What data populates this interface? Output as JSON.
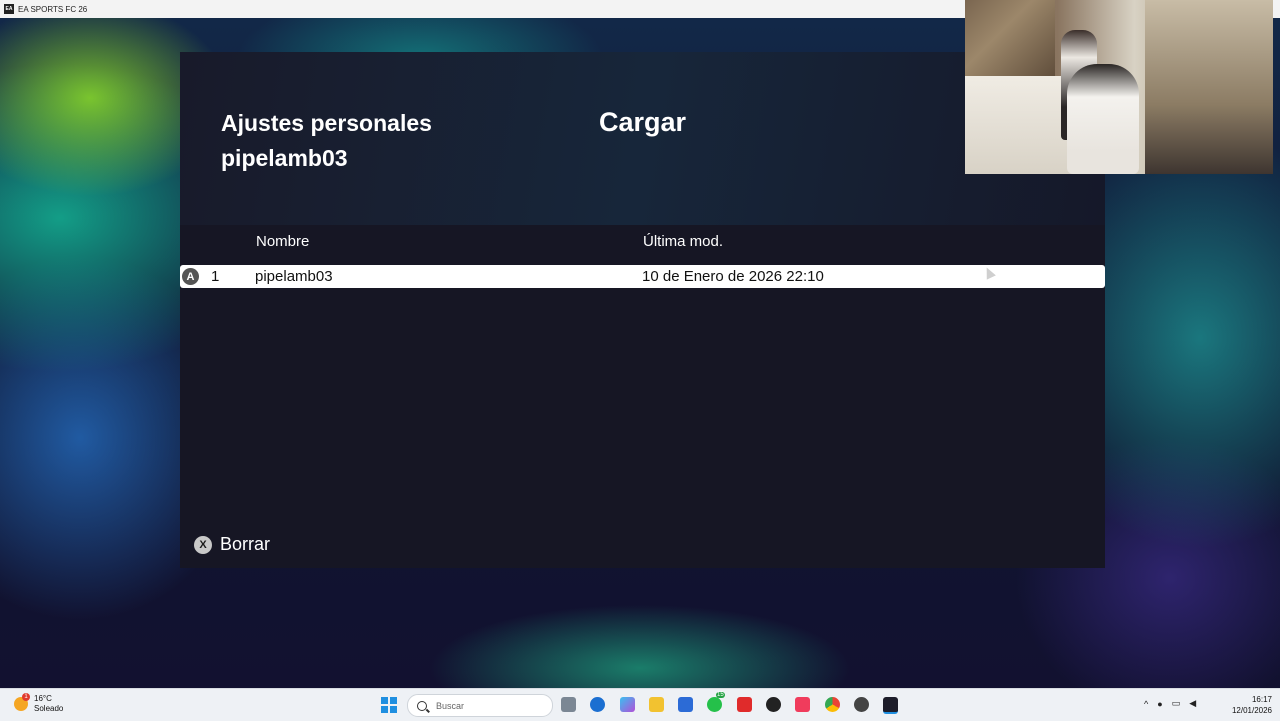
{
  "window": {
    "title": "EA SPORTS FC 26",
    "app_icon_label": "EA"
  },
  "panel": {
    "title": "Cargar",
    "heading_line1": "Ajustes personales",
    "heading_line2": "pipelamb03",
    "columns": {
      "name": "Nombre",
      "modified": "Última mod."
    },
    "rows": [
      {
        "button": "A",
        "index": "1",
        "name": "pipelamb03",
        "modified": "10 de Enero de 2026 22:10"
      }
    ],
    "footer": {
      "button": "X",
      "label": "Borrar"
    }
  },
  "taskbar": {
    "weather": {
      "temperature": "16°C",
      "condition": "Soleado",
      "badge": "1"
    },
    "search_placeholder": "Buscar",
    "whatsapp_badge": "15",
    "clock": {
      "time": "16:17",
      "date": "12/01/2026"
    }
  },
  "colors": {
    "panel": "#161624",
    "selected_row": "#ffffff",
    "taskbar": "#eef1f5",
    "accent": "#1f8fe0"
  }
}
